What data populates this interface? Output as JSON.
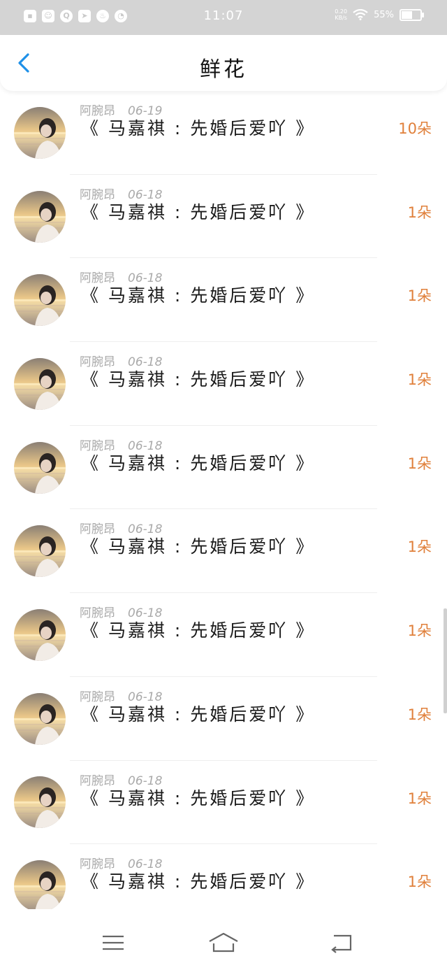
{
  "status_bar": {
    "time": "11:07",
    "net_speed_top": "0.20",
    "net_speed_bottom": "KB/s",
    "battery": "55%",
    "left_icons": [
      "sim-icon",
      "app-icon",
      "qq-icon",
      "telegram-icon",
      "fire-icon",
      "gauge-icon"
    ]
  },
  "header": {
    "title": "鲜花",
    "back_icon": "chevron-left-icon"
  },
  "colors": {
    "accent": "#1e90e8",
    "count": "#e0803b",
    "meta": "#a9a9a9"
  },
  "items": [
    {
      "user": "阿腕昂",
      "date": "06-19",
      "title": "《 马嘉祺 : 先婚后爱吖 》",
      "count": "10朵"
    },
    {
      "user": "阿腕昂",
      "date": "06-18",
      "title": "《 马嘉祺 : 先婚后爱吖 》",
      "count": "1朵"
    },
    {
      "user": "阿腕昂",
      "date": "06-18",
      "title": "《 马嘉祺 : 先婚后爱吖 》",
      "count": "1朵"
    },
    {
      "user": "阿腕昂",
      "date": "06-18",
      "title": "《 马嘉祺 : 先婚后爱吖 》",
      "count": "1朵"
    },
    {
      "user": "阿腕昂",
      "date": "06-18",
      "title": "《 马嘉祺 : 先婚后爱吖 》",
      "count": "1朵"
    },
    {
      "user": "阿腕昂",
      "date": "06-18",
      "title": "《 马嘉祺 : 先婚后爱吖 》",
      "count": "1朵"
    },
    {
      "user": "阿腕昂",
      "date": "06-18",
      "title": "《 马嘉祺 : 先婚后爱吖 》",
      "count": "1朵"
    },
    {
      "user": "阿腕昂",
      "date": "06-18",
      "title": "《 马嘉祺 : 先婚后爱吖 》",
      "count": "1朵"
    },
    {
      "user": "阿腕昂",
      "date": "06-18",
      "title": "《 马嘉祺 : 先婚后爱吖 》",
      "count": "1朵"
    },
    {
      "user": "阿腕昂",
      "date": "06-18",
      "title": "《 马嘉祺 : 先婚后爱吖 》",
      "count": "1朵"
    }
  ],
  "nav": {
    "icons": [
      "menu-icon",
      "home-icon",
      "back-icon"
    ]
  }
}
